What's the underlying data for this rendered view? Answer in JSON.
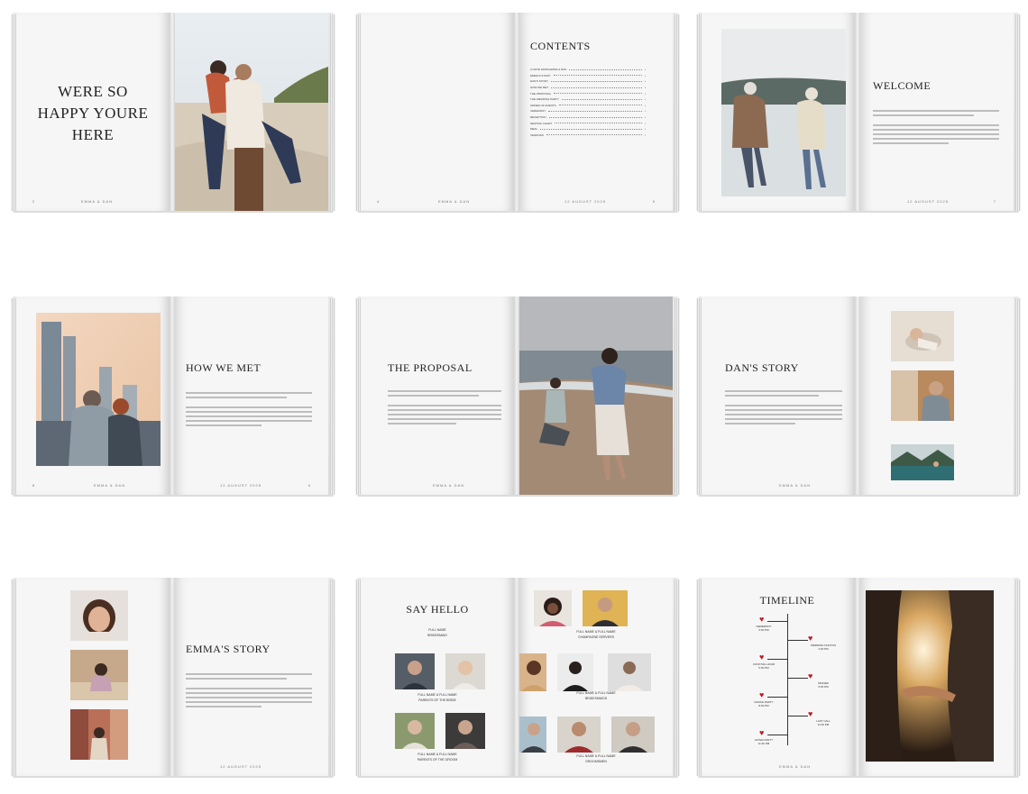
{
  "spreads": {
    "s1": {
      "heading": "WERE SO HAPPY YOURE HERE",
      "footer": "EMMA & DAN",
      "page_num": "2"
    },
    "s2": {
      "heading": "CONTENTS",
      "footer_left": "EMMA & DAN",
      "footer_right": "12 AUGUST 2025",
      "page_left": "4",
      "page_right": "5",
      "toc": [
        "A NOTE FROM EMMA & DAN",
        "EMMA'S STORY",
        "DAN'S STORY",
        "HOW WE MET",
        "THE PROPOSAL",
        "THE WEDDING PARTY",
        "ORDER OF EVENTS",
        "CEREMONY",
        "RECEPTION",
        "SEATING CHART",
        "MEAL",
        "VENDORS"
      ]
    },
    "s3": {
      "heading": "WELCOME",
      "footer": "12 AUGUST 2025",
      "page_num": "7"
    },
    "s4": {
      "heading": "HOW WE MET",
      "footer_left": "EMMA & DAN",
      "footer_right": "12 AUGUST 2025",
      "page_left": "8",
      "page_right": "9"
    },
    "s5": {
      "heading": "THE PROPOSAL",
      "footer": "EMMA & DAN"
    },
    "s6": {
      "heading": "DAN'S STORY",
      "footer": "EMMA & DAN"
    },
    "s7": {
      "heading": "EMMA'S STORY",
      "footer": "12 AUGUST 2025"
    },
    "s8": {
      "heading": "SAY HELLO",
      "top_name": "FULL NAME",
      "top_role": "BRIDESMAID",
      "name_a": "FULL NAME & FULL NAME",
      "role_a": "PARENTS OF THE BRIDE",
      "name_b": "FULL NAME & FULL NAME",
      "role_b": "PARENTS OF THE GROOM",
      "name_c": "FULL NAME & FULL NAME",
      "role_c": "CHAMPAGNE SERVERS",
      "name_d": "FULL NAME & FULL NAME",
      "role_d": "BRIDESMAIDS",
      "name_e": "FULL NAME & FULL NAME",
      "role_e": "GROOMSMEN"
    },
    "s9": {
      "heading": "TIMELINE",
      "footer": "EMMA & DAN",
      "events": [
        {
          "label": "CEREMONY",
          "time": "3:00 PM"
        },
        {
          "label": "WEDDING PHOTOS",
          "time": "4:00 PM"
        },
        {
          "label": "COCKTAIL HOUR",
          "time": "5:00 PM"
        },
        {
          "label": "DINNER",
          "time": "6:00 PM"
        },
        {
          "label": "DANCE PARTY",
          "time": "8:00 PM"
        },
        {
          "label": "LAST CALL",
          "time": "11:00 PM"
        },
        {
          "label": "AFTER PARTY",
          "time": "11:30 PM"
        }
      ]
    }
  },
  "colors": {
    "heart": "#c0192a",
    "page": "#f6f6f6",
    "rule": "#bdbdbd"
  }
}
